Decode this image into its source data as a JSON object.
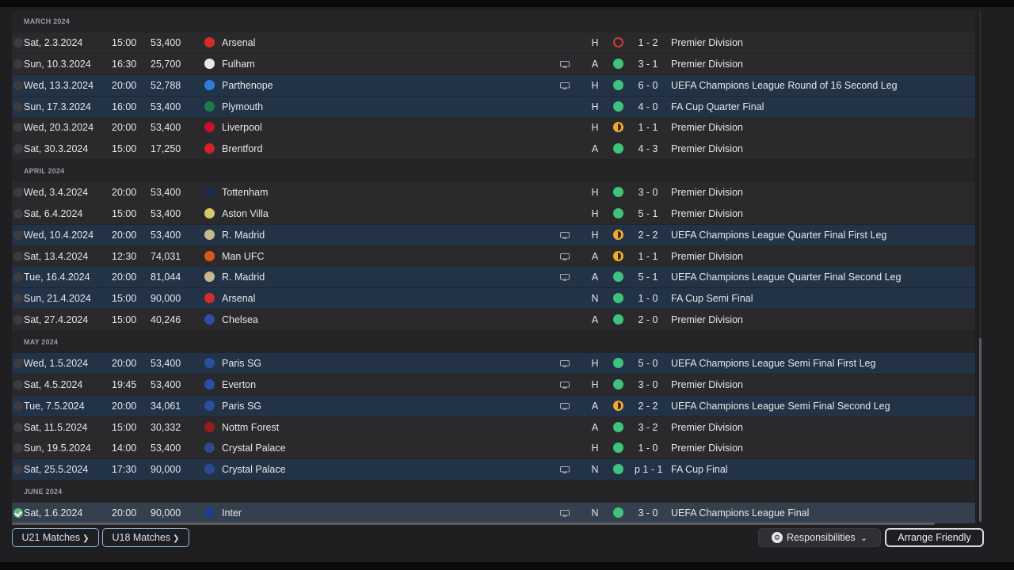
{
  "months": [
    {
      "label": "MARCH 2024",
      "matches": [
        {
          "date": "Sat, 2.3.2024",
          "time": "15:00",
          "attendance": "53,400",
          "team": "Arsenal",
          "crest_color": "#d52b2b",
          "tv": false,
          "venue": "H",
          "result": "loss",
          "score": "1 - 2",
          "competition": "Premier Division",
          "highlight": false
        },
        {
          "date": "Sun, 10.3.2024",
          "time": "16:30",
          "attendance": "25,700",
          "team": "Fulham",
          "crest_color": "#e8e8e8",
          "tv": true,
          "venue": "A",
          "result": "win",
          "score": "3 - 1",
          "competition": "Premier Division",
          "highlight": false
        },
        {
          "date": "Wed, 13.3.2024",
          "time": "20:00",
          "attendance": "52,788",
          "team": "Parthenope",
          "crest_color": "#2d7ed8",
          "tv": true,
          "venue": "H",
          "result": "win",
          "score": "6 - 0",
          "competition": "UEFA Champions League Round of 16 Second Leg",
          "highlight": true
        },
        {
          "date": "Sun, 17.3.2024",
          "time": "16:00",
          "attendance": "53,400",
          "team": "Plymouth",
          "crest_color": "#1f7a4a",
          "tv": false,
          "venue": "H",
          "result": "win",
          "score": "4 - 0",
          "competition": "FA Cup Quarter Final",
          "highlight": true
        },
        {
          "date": "Wed, 20.3.2024",
          "time": "20:00",
          "attendance": "53,400",
          "team": "Liverpool",
          "crest_color": "#c8102e",
          "tv": false,
          "venue": "H",
          "result": "draw",
          "score": "1 - 1",
          "competition": "Premier Division",
          "highlight": false
        },
        {
          "date": "Sat, 30.3.2024",
          "time": "15:00",
          "attendance": "17,250",
          "team": "Brentford",
          "crest_color": "#d4202a",
          "tv": false,
          "venue": "A",
          "result": "win",
          "score": "4 - 3",
          "competition": "Premier Division",
          "highlight": false
        }
      ]
    },
    {
      "label": "APRIL 2024",
      "matches": [
        {
          "date": "Wed, 3.4.2024",
          "time": "20:00",
          "attendance": "53,400",
          "team": "Tottenham",
          "crest_color": "#1a2a55",
          "tv": false,
          "venue": "H",
          "result": "win",
          "score": "3 - 0",
          "competition": "Premier Division",
          "highlight": false
        },
        {
          "date": "Sat, 6.4.2024",
          "time": "15:00",
          "attendance": "53,400",
          "team": "Aston Villa",
          "crest_color": "#d6c96b",
          "tv": false,
          "venue": "H",
          "result": "win",
          "score": "5 - 1",
          "competition": "Premier Division",
          "highlight": false
        },
        {
          "date": "Wed, 10.4.2024",
          "time": "20:00",
          "attendance": "53,400",
          "team": "R. Madrid",
          "crest_color": "#c9b98a",
          "tv": true,
          "venue": "H",
          "result": "draw",
          "score": "2 - 2",
          "competition": "UEFA Champions League Quarter Final First Leg",
          "highlight": true
        },
        {
          "date": "Sat, 13.4.2024",
          "time": "12:30",
          "attendance": "74,031",
          "team": "Man UFC",
          "crest_color": "#e0531f",
          "tv": true,
          "venue": "A",
          "result": "draw",
          "score": "1 - 1",
          "competition": "Premier Division",
          "highlight": false
        },
        {
          "date": "Tue, 16.4.2024",
          "time": "20:00",
          "attendance": "81,044",
          "team": "R. Madrid",
          "crest_color": "#c9b98a",
          "tv": true,
          "venue": "A",
          "result": "win",
          "score": "5 - 1",
          "competition": "UEFA Champions League Quarter Final Second Leg",
          "highlight": true
        },
        {
          "date": "Sun, 21.4.2024",
          "time": "15:00",
          "attendance": "90,000",
          "team": "Arsenal",
          "crest_color": "#d52b2b",
          "tv": false,
          "venue": "N",
          "result": "win",
          "score": "1 - 0",
          "competition": "FA Cup Semi Final",
          "highlight": true
        },
        {
          "date": "Sat, 27.4.2024",
          "time": "15:00",
          "attendance": "40,246",
          "team": "Chelsea",
          "crest_color": "#2f4ea8",
          "tv": false,
          "venue": "A",
          "result": "win",
          "score": "2 - 0",
          "competition": "Premier Division",
          "highlight": false
        }
      ]
    },
    {
      "label": "MAY 2024",
      "matches": [
        {
          "date": "Wed, 1.5.2024",
          "time": "20:00",
          "attendance": "53,400",
          "team": "Paris SG",
          "crest_color": "#2c4f9e",
          "tv": true,
          "venue": "H",
          "result": "win",
          "score": "5 - 0",
          "competition": "UEFA Champions League Semi Final First Leg",
          "highlight": true
        },
        {
          "date": "Sat, 4.5.2024",
          "time": "19:45",
          "attendance": "53,400",
          "team": "Everton",
          "crest_color": "#2a4fa8",
          "tv": true,
          "venue": "H",
          "result": "win",
          "score": "3 - 0",
          "competition": "Premier Division",
          "highlight": false
        },
        {
          "date": "Tue, 7.5.2024",
          "time": "20:00",
          "attendance": "34,061",
          "team": "Paris SG",
          "crest_color": "#2c4f9e",
          "tv": true,
          "venue": "A",
          "result": "draw",
          "score": "2 - 2",
          "competition": "UEFA Champions League Semi Final Second Leg",
          "highlight": true
        },
        {
          "date": "Sat, 11.5.2024",
          "time": "15:00",
          "attendance": "30,332",
          "team": "Nottm Forest",
          "crest_color": "#9a1b1b",
          "tv": false,
          "venue": "A",
          "result": "win",
          "score": "3 - 2",
          "competition": "Premier Division",
          "highlight": false
        },
        {
          "date": "Sun, 19.5.2024",
          "time": "14:00",
          "attendance": "53,400",
          "team": "Crystal Palace",
          "crest_color": "#2e4a8e",
          "tv": false,
          "venue": "H",
          "result": "win",
          "score": "1 - 0",
          "competition": "Premier Division",
          "highlight": false
        },
        {
          "date": "Sat, 25.5.2024",
          "time": "17:30",
          "attendance": "90,000",
          "team": "Crystal Palace",
          "crest_color": "#2e4a8e",
          "tv": true,
          "venue": "N",
          "result": "win",
          "score": "p 1 - 1",
          "competition": "FA Cup Final",
          "highlight": true
        }
      ]
    },
    {
      "label": "JUNE 2024",
      "matches": [
        {
          "date": "Sat, 1.6.2024",
          "time": "20:00",
          "attendance": "90,000",
          "team": "Inter",
          "crest_color": "#1d3c8f",
          "tv": true,
          "venue": "N",
          "result": "win",
          "score": "3 - 0",
          "competition": "UEFA Champions League Final",
          "highlight": true,
          "selected": true,
          "checked": true
        }
      ]
    }
  ],
  "buttons": {
    "u21": "U21 Matches",
    "u18": "U18 Matches",
    "responsibilities": "Responsibilities",
    "arrange": "Arrange Friendly"
  }
}
